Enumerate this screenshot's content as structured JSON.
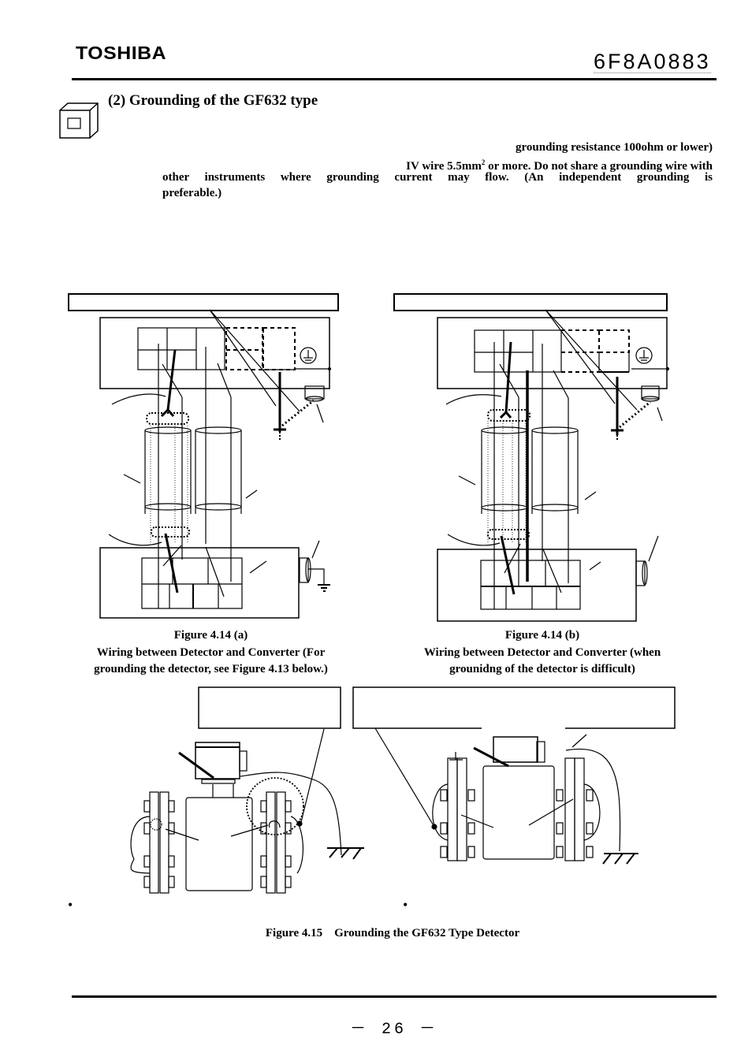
{
  "header": {
    "brand": "TOSHIBA",
    "document_number": "6F8A0883"
  },
  "section": {
    "heading": "(2) Grounding of the GF632 type",
    "icon": "instruction-cube-icon",
    "paragraph_lines": [
      "grounding resistance 100ohm or lower)",
      "IV wire 5.5mm",
      "2",
      " or more. Do not share a grounding wire with",
      "other instruments where grounding current may flow. (An independent grounding is",
      "preferable.)"
    ]
  },
  "figures": {
    "fig_a": {
      "number": "Figure 4.14 (a)",
      "caption_line1": "Wiring between Detector and Converter (For",
      "caption_line2": "grounding the detector, see Figure 4.13 below.)"
    },
    "fig_b": {
      "number": "Figure 4.14 (b)",
      "caption_line1": "Wiring between Detector and Converter (when",
      "caption_line2": "grounidng of the detector is difficult)"
    },
    "fig_15": {
      "caption": "Figure 4.15    Grounding the GF632 Type Detector",
      "bullets": [
        "•",
        "•"
      ]
    }
  },
  "footer": {
    "page_number": "－ 26 －"
  }
}
